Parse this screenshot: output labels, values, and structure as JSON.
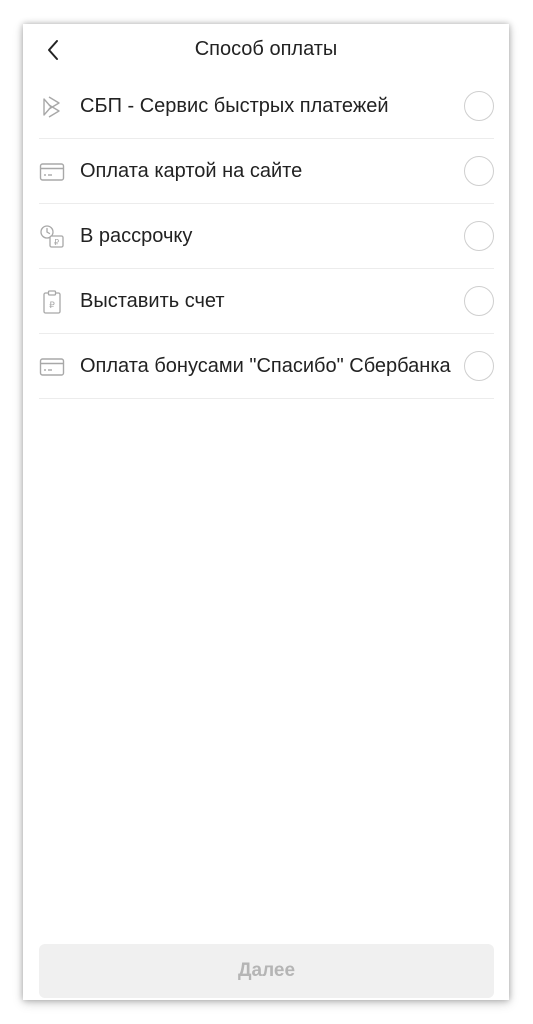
{
  "header": {
    "title": "Способ оплаты"
  },
  "payment_methods": [
    {
      "label": "СБП - Сервис быстрых платежей",
      "icon": "sbp-icon",
      "selected": false
    },
    {
      "label": "Оплата картой на сайте",
      "icon": "card-icon",
      "selected": false
    },
    {
      "label": "В рассрочку",
      "icon": "installment-icon",
      "selected": false
    },
    {
      "label": "Выставить счет",
      "icon": "invoice-icon",
      "selected": false
    },
    {
      "label": "Оплата бонусами \"Спасибо\" Сбербанка",
      "icon": "card-icon",
      "selected": false
    }
  ],
  "footer": {
    "continue_label": "Далее",
    "continue_enabled": false
  },
  "colors": {
    "text": "#222222",
    "icon": "#a8a8a8",
    "divider": "#ececec",
    "radio_border": "#cfcfcf",
    "disabled_button_bg": "#f0f0f0",
    "disabled_button_text": "#b5b5b5"
  }
}
